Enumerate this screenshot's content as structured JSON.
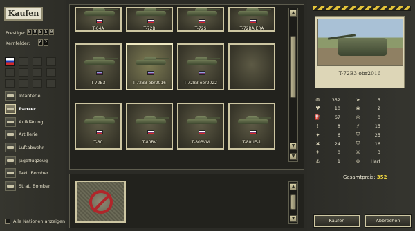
{
  "window": {
    "title": "Kaufen"
  },
  "left": {
    "prestige_label": "Prestige:",
    "prestige_digits": [
      "0",
      "0",
      "5",
      "5",
      "0"
    ],
    "core_label": "Kernfelder:",
    "core_digits": [
      "0",
      "2"
    ],
    "categories": [
      {
        "label": "Infanterie",
        "icon": "infantry-icon"
      },
      {
        "label": "Panzer",
        "icon": "tank-icon"
      },
      {
        "label": "Aufklärung",
        "icon": "recon-icon"
      },
      {
        "label": "Artillerie",
        "icon": "artillery-icon"
      },
      {
        "label": "Luftabwehr",
        "icon": "anti-air-icon"
      },
      {
        "label": "Jagdflugzeug",
        "icon": "fighter-icon"
      },
      {
        "label": "Takt. Bomber",
        "icon": "tactical-bomber-icon"
      },
      {
        "label": "Strat. Bomber",
        "icon": "strategic-bomber-icon"
      }
    ],
    "active_category": "Panzer",
    "all_nations_label": "Alle Nationen anzeigen"
  },
  "units": {
    "rows": [
      [
        "T-64A",
        "T-72B",
        "T-72S",
        "T-72BA ERA"
      ],
      [
        "T-72B3",
        "T-72B3 obr2016",
        "T-72B3 obr2022",
        ""
      ],
      [
        "T-80",
        "T-80BV",
        "T-80BVM",
        "T-80UE-1"
      ]
    ],
    "selected": "T-72B3 obr2016"
  },
  "detail": {
    "name": "T-72B3 obr2016",
    "stats_left": [
      {
        "icon": "cost-icon",
        "value": "352"
      },
      {
        "icon": "strength-icon",
        "value": "10"
      },
      {
        "icon": "fuel-icon",
        "value": "67"
      },
      {
        "icon": "ammo-icon",
        "value": "8"
      },
      {
        "icon": "soft-attack-icon",
        "value": "6"
      },
      {
        "icon": "hard-attack-icon",
        "value": "24"
      },
      {
        "icon": "air-attack-icon",
        "value": "0"
      },
      {
        "icon": "naval-attack-icon",
        "value": "1"
      }
    ],
    "stats_right": [
      {
        "icon": "movement-icon",
        "value": "5"
      },
      {
        "icon": "spotting-icon",
        "value": "2"
      },
      {
        "icon": "range-icon",
        "value": "0"
      },
      {
        "icon": "initiative-icon",
        "value": "15"
      },
      {
        "icon": "ground-defense-icon",
        "value": "25"
      },
      {
        "icon": "air-defense-icon",
        "value": "16"
      },
      {
        "icon": "close-defense-icon",
        "value": "3"
      },
      {
        "icon": "target-type-icon",
        "value": "Hart"
      }
    ],
    "total_label": "Gesamtpreis:",
    "total_value": "352"
  },
  "buttons": {
    "buy": "Kaufen",
    "cancel": "Abbrechen"
  },
  "colors": {
    "accent": "#f0d640",
    "frame": "#cfc8a3",
    "hazard": "#e2c23a"
  }
}
